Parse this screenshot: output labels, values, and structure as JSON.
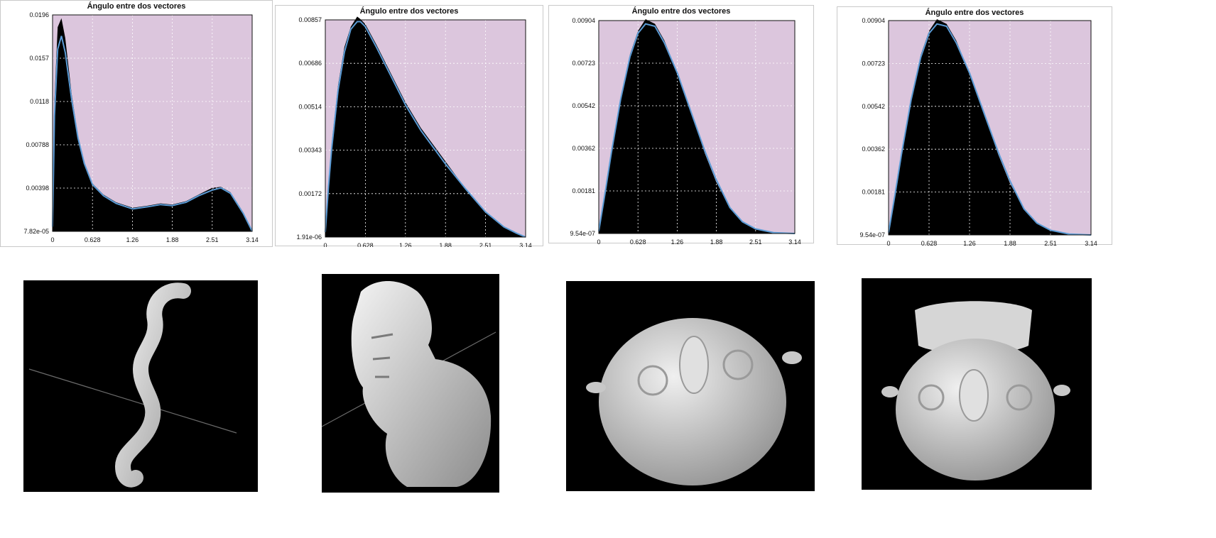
{
  "colors": {
    "plot_background": "#dcc6dd",
    "histogram_fill": "#000000",
    "fit_line": "#5b9bd5",
    "grid": "#ffffff",
    "render_background": "#000000",
    "model_surface": "#d4d4d4"
  },
  "chart_data": [
    {
      "type": "area",
      "title": "Ángulo entre dos vectores",
      "xlabel": "",
      "ylabel": "",
      "xlim": [
        0,
        3.14
      ],
      "ylim": [
        7.82e-05,
        0.0196
      ],
      "x_ticks": [
        "0",
        "0.628",
        "1.26",
        "1.88",
        "2.51",
        "3.14"
      ],
      "y_ticks": [
        "7.82e-05",
        "0.00398",
        "0.00788",
        "0.0118",
        "0.0157",
        "0.0196"
      ],
      "grid": true,
      "series": [
        {
          "x": [
            0,
            0.03,
            0.08,
            0.14,
            0.2,
            0.3,
            0.4,
            0.5,
            0.628,
            0.8,
            1.0,
            1.26,
            1.5,
            1.7,
            1.88,
            2.1,
            2.3,
            2.51,
            2.65,
            2.8,
            3.0,
            3.14
          ],
          "values": [
            0.0005,
            0.012,
            0.0185,
            0.0193,
            0.0175,
            0.0125,
            0.0087,
            0.0063,
            0.0044,
            0.0034,
            0.0027,
            0.0022,
            0.0024,
            0.0026,
            0.0025,
            0.0028,
            0.0034,
            0.004,
            0.0041,
            0.0036,
            0.0018,
            0.0001
          ]
        },
        {
          "x": [
            0,
            0.03,
            0.08,
            0.14,
            0.2,
            0.3,
            0.4,
            0.5,
            0.628,
            0.8,
            1.0,
            1.26,
            1.5,
            1.7,
            1.88,
            2.1,
            2.3,
            2.51,
            2.65,
            2.8,
            3.0,
            3.14
          ],
          "values": [
            0.0005,
            0.0105,
            0.0165,
            0.0177,
            0.0162,
            0.012,
            0.0085,
            0.0062,
            0.0043,
            0.0033,
            0.0026,
            0.0021,
            0.0023,
            0.0025,
            0.0024,
            0.0027,
            0.0033,
            0.0038,
            0.004,
            0.0035,
            0.0017,
            0.0001
          ]
        }
      ]
    },
    {
      "type": "area",
      "title": "Ángulo entre dos vectores",
      "xlabel": "",
      "ylabel": "",
      "xlim": [
        0,
        3.14
      ],
      "ylim": [
        1.91e-06,
        0.00857
      ],
      "x_ticks": [
        "0",
        "0.628",
        "1.26",
        "1.88",
        "2.51",
        "3.14"
      ],
      "y_ticks": [
        "1.91e-06",
        "0.00172",
        "0.00343",
        "0.00514",
        "0.00686",
        "0.00857"
      ],
      "grid": true,
      "series": [
        {
          "x": [
            0,
            0.05,
            0.1,
            0.2,
            0.3,
            0.4,
            0.5,
            0.55,
            0.628,
            0.8,
            1.0,
            1.26,
            1.5,
            1.88,
            2.2,
            2.51,
            2.8,
            3.0,
            3.14
          ],
          "values": [
            0.0002,
            0.0022,
            0.0037,
            0.006,
            0.0075,
            0.0083,
            0.0087,
            0.0086,
            0.0084,
            0.0076,
            0.0066,
            0.0053,
            0.0043,
            0.003,
            0.0019,
            0.001,
            0.0004,
            0.00015,
            0.0
          ]
        },
        {
          "x": [
            0,
            0.05,
            0.1,
            0.2,
            0.3,
            0.4,
            0.5,
            0.55,
            0.628,
            0.8,
            1.0,
            1.26,
            1.5,
            1.88,
            2.2,
            2.51,
            2.8,
            3.0,
            3.14
          ],
          "values": [
            0.0002,
            0.002,
            0.0035,
            0.0058,
            0.0073,
            0.0082,
            0.0085,
            0.0085,
            0.0083,
            0.0075,
            0.0065,
            0.0052,
            0.0042,
            0.0029,
            0.0019,
            0.001,
            0.0004,
            0.00015,
            0.0
          ]
        }
      ]
    },
    {
      "type": "area",
      "title": "Ángulo entre dos vectores",
      "xlabel": "",
      "ylabel": "",
      "xlim": [
        0,
        3.14
      ],
      "ylim": [
        9.54e-07,
        0.00904
      ],
      "x_ticks": [
        "0",
        "0.628",
        "1.26",
        "1.88",
        "2.51",
        "3.14"
      ],
      "y_ticks": [
        "9.54e-07",
        "0.00181",
        "0.00362",
        "0.00542",
        "0.00723",
        "0.00904"
      ],
      "grid": true,
      "series": [
        {
          "x": [
            0,
            0.1,
            0.2,
            0.35,
            0.5,
            0.628,
            0.75,
            0.9,
            1.05,
            1.26,
            1.5,
            1.7,
            1.88,
            2.1,
            2.3,
            2.51,
            2.8,
            3.14
          ],
          "values": [
            0.0001,
            0.0018,
            0.0035,
            0.0058,
            0.0076,
            0.0086,
            0.0091,
            0.0089,
            0.0082,
            0.0068,
            0.005,
            0.0034,
            0.0022,
            0.0011,
            0.0005,
            0.0002,
            4e-05,
            0.0
          ]
        },
        {
          "x": [
            0,
            0.1,
            0.2,
            0.35,
            0.5,
            0.628,
            0.75,
            0.9,
            1.05,
            1.26,
            1.5,
            1.7,
            1.88,
            2.1,
            2.3,
            2.51,
            2.8,
            3.14
          ],
          "values": [
            0.0001,
            0.0017,
            0.0034,
            0.0057,
            0.0075,
            0.0085,
            0.0089,
            0.0088,
            0.0081,
            0.0068,
            0.005,
            0.0035,
            0.0023,
            0.0011,
            0.0005,
            0.0002,
            4e-05,
            0.0
          ]
        }
      ]
    },
    {
      "type": "area",
      "title": "Ángulo entre dos vectores",
      "xlabel": "",
      "ylabel": "",
      "xlim": [
        0,
        3.14
      ],
      "ylim": [
        9.54e-07,
        0.00904
      ],
      "x_ticks": [
        "0",
        "0.628",
        "1.26",
        "1.88",
        "2.51",
        "3.14"
      ],
      "y_ticks": [
        "9.54e-07",
        "0.00181",
        "0.00362",
        "0.00542",
        "0.00723",
        "0.00904"
      ],
      "grid": true,
      "series": [
        {
          "x": [
            0,
            0.1,
            0.2,
            0.35,
            0.5,
            0.628,
            0.75,
            0.9,
            1.05,
            1.26,
            1.5,
            1.7,
            1.88,
            2.1,
            2.3,
            2.51,
            2.8,
            3.14
          ],
          "values": [
            0.0001,
            0.0018,
            0.0035,
            0.0058,
            0.0076,
            0.0086,
            0.0091,
            0.0089,
            0.0082,
            0.0068,
            0.005,
            0.0034,
            0.0022,
            0.0011,
            0.0005,
            0.0002,
            4e-05,
            0.0
          ]
        },
        {
          "x": [
            0,
            0.1,
            0.2,
            0.35,
            0.5,
            0.628,
            0.75,
            0.9,
            1.05,
            1.26,
            1.5,
            1.7,
            1.88,
            2.1,
            2.3,
            2.51,
            2.8,
            3.14
          ],
          "values": [
            0.0001,
            0.0017,
            0.0034,
            0.0057,
            0.0075,
            0.0085,
            0.0089,
            0.0088,
            0.0081,
            0.0068,
            0.005,
            0.0035,
            0.0023,
            0.0011,
            0.0005,
            0.0002,
            4e-05,
            0.0
          ]
        }
      ]
    }
  ]
}
